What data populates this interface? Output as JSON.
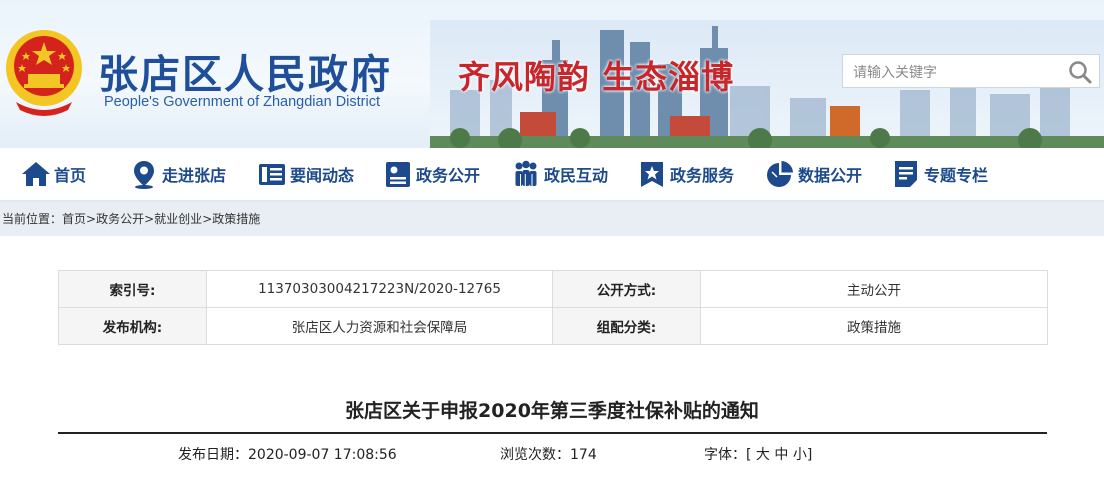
{
  "header": {
    "title_cn": "张店区人民政府",
    "title_en": "People's Government of Zhangdian District",
    "slogan": "齐风陶韵  生态淄博",
    "search_placeholder": "请输入关键字"
  },
  "nav": {
    "items": [
      {
        "label": "首页",
        "icon": "home-icon"
      },
      {
        "label": "走进张店",
        "icon": "location-pin-icon"
      },
      {
        "label": "要闻动态",
        "icon": "newspaper-icon"
      },
      {
        "label": "政务公开",
        "icon": "document-icon"
      },
      {
        "label": "政民互动",
        "icon": "people-icon"
      },
      {
        "label": "政务服务",
        "icon": "star-badge-icon"
      },
      {
        "label": "数据公开",
        "icon": "pie-chart-icon"
      },
      {
        "label": "专题专栏",
        "icon": "list-document-icon"
      }
    ]
  },
  "breadcrumb": {
    "label": "当前位置：",
    "items": [
      "首页",
      "政务公开",
      "就业创业",
      "政策措施"
    ],
    "separator": ">"
  },
  "meta": {
    "index_label": "索引号:",
    "index_value": "11370303004217223N/2020-12765",
    "open_label": "公开方式:",
    "open_value": "主动公开",
    "publisher_label": "发布机构:",
    "publisher_value": "张店区人力资源和社会保障局",
    "category_label": "组配分类:",
    "category_value": "政策措施"
  },
  "article": {
    "title": "张店区关于申报2020年第三季度社保补贴的通知",
    "date_label": "发布日期：",
    "date_value": "2020-09-07 17:08:56",
    "views_label": "浏览次数：",
    "views_value": "174",
    "font_label": "字体：",
    "font_open": "[",
    "font_large": "大",
    "font_medium": "中",
    "font_small": "小",
    "font_close": "]"
  },
  "colors": {
    "primary": "#1c4a8c",
    "slogan_red": "#c8262a",
    "emblem_red": "#d3231c",
    "emblem_gold": "#f3c623"
  }
}
